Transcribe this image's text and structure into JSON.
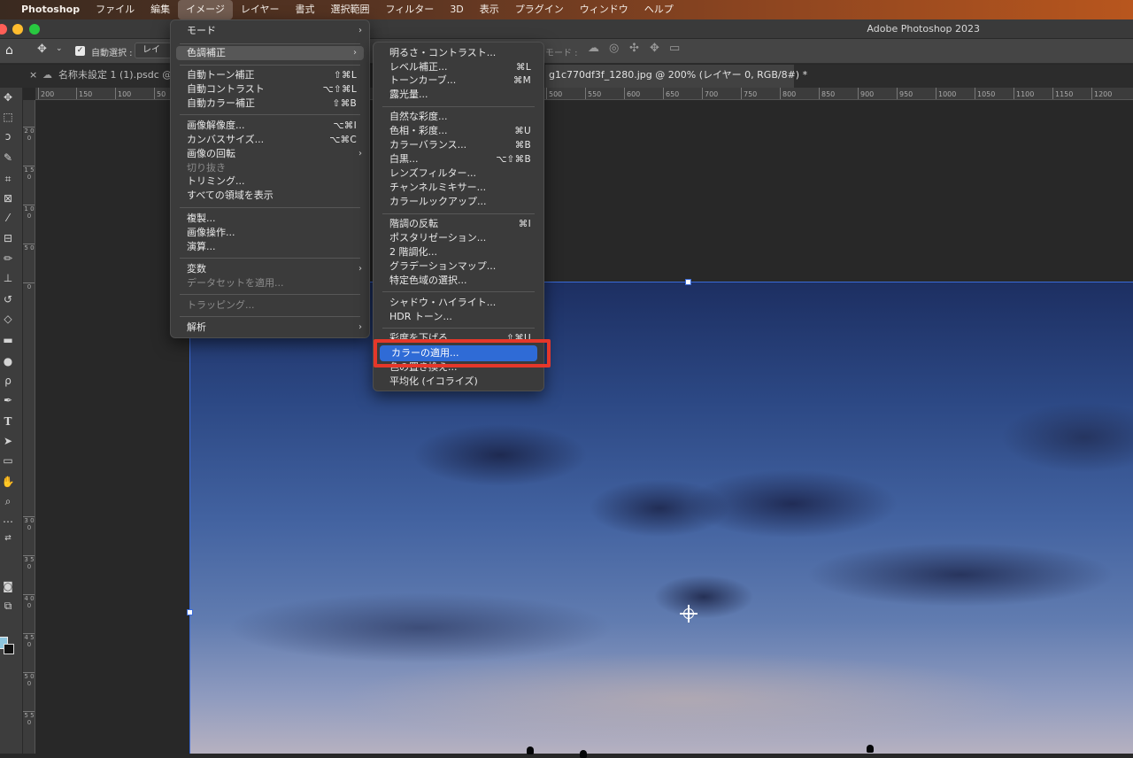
{
  "menubar": {
    "app_name": "Photoshop",
    "items": [
      "ファイル",
      "編集",
      "イメージ",
      "レイヤー",
      "書式",
      "選択範囲",
      "フィルター",
      "3D",
      "表示",
      "プラグイン",
      "ウィンドウ",
      "ヘルプ"
    ],
    "active_item": "イメージ"
  },
  "window": {
    "title": "Adobe Photoshop 2023"
  },
  "options_bar": {
    "auto_select_label": "自動選択 :",
    "auto_select_value": "レイヤー",
    "mode_label": "モード :"
  },
  "tabs": [
    {
      "label": "名称未設定 1 (1).psdc @"
    },
    {
      "label": "g1c770df3f_1280.jpg @ 200% (レイヤー 0, RGB/8#) *"
    }
  ],
  "rulers": {
    "h_ticks": [
      "200",
      "150",
      "100",
      "50",
      "500",
      "550",
      "600",
      "650",
      "700",
      "750",
      "800",
      "850",
      "900",
      "950",
      "1000",
      "1050",
      "1100",
      "1150",
      "1200"
    ],
    "v_ticks": [
      "2 0 0",
      "1 5 0",
      "1 0 0",
      "5 0",
      "0",
      "3 0 0",
      "3 5 0",
      "4 0 0",
      "4 5 0",
      "5 0 0",
      "5 5 0"
    ]
  },
  "image_menu": {
    "items": [
      {
        "label": "モード",
        "submenu": true
      },
      {
        "label": "色調補正",
        "submenu": true,
        "highlighted": true
      },
      {
        "label": "自動トーン補正",
        "shortcut": "⇧⌘L"
      },
      {
        "label": "自動コントラスト",
        "shortcut": "⌥⇧⌘L"
      },
      {
        "label": "自動カラー補正",
        "shortcut": "⇧⌘B"
      },
      {
        "label": "画像解像度...",
        "shortcut": "⌥⌘I"
      },
      {
        "label": "カンバスサイズ...",
        "shortcut": "⌥⌘C"
      },
      {
        "label": "画像の回転",
        "submenu": true
      },
      {
        "label": "切り抜き",
        "disabled": true
      },
      {
        "label": "トリミング..."
      },
      {
        "label": "すべての領域を表示"
      },
      {
        "label": "複製..."
      },
      {
        "label": "画像操作..."
      },
      {
        "label": "演算..."
      },
      {
        "label": "変数",
        "submenu": true
      },
      {
        "label": "データセットを適用...",
        "disabled": true
      },
      {
        "label": "トラッピング...",
        "disabled": true
      },
      {
        "label": "解析",
        "submenu": true
      }
    ]
  },
  "adjustments_menu": {
    "items": [
      {
        "label": "明るさ・コントラスト..."
      },
      {
        "label": "レベル補正...",
        "shortcut": "⌘L"
      },
      {
        "label": "トーンカーブ...",
        "shortcut": "⌘M"
      },
      {
        "label": "露光量..."
      },
      {
        "label": "自然な彩度..."
      },
      {
        "label": "色相・彩度...",
        "shortcut": "⌘U"
      },
      {
        "label": "カラーバランス...",
        "shortcut": "⌘B"
      },
      {
        "label": "白黒...",
        "shortcut": "⌥⇧⌘B"
      },
      {
        "label": "レンズフィルター..."
      },
      {
        "label": "チャンネルミキサー..."
      },
      {
        "label": "カラールックアップ..."
      },
      {
        "label": "階調の反転",
        "shortcut": "⌘I"
      },
      {
        "label": "ポスタリゼーション..."
      },
      {
        "label": "2 階調化..."
      },
      {
        "label": "グラデーションマップ..."
      },
      {
        "label": "特定色域の選択..."
      },
      {
        "label": "シャドウ・ハイライト..."
      },
      {
        "label": "HDR トーン..."
      },
      {
        "label": "彩度を下げる",
        "shortcut": "⇧⌘U"
      },
      {
        "label": "カラーの適用...",
        "selected": true
      },
      {
        "label": "色の置き換え..."
      },
      {
        "label": "平均化 (イコライズ)"
      }
    ]
  },
  "colors": {
    "menu_selection": "#2f6bd6",
    "annotation": "#e5372a",
    "foreground_swatch": "#8ec6de",
    "background_swatch": "#111111"
  }
}
